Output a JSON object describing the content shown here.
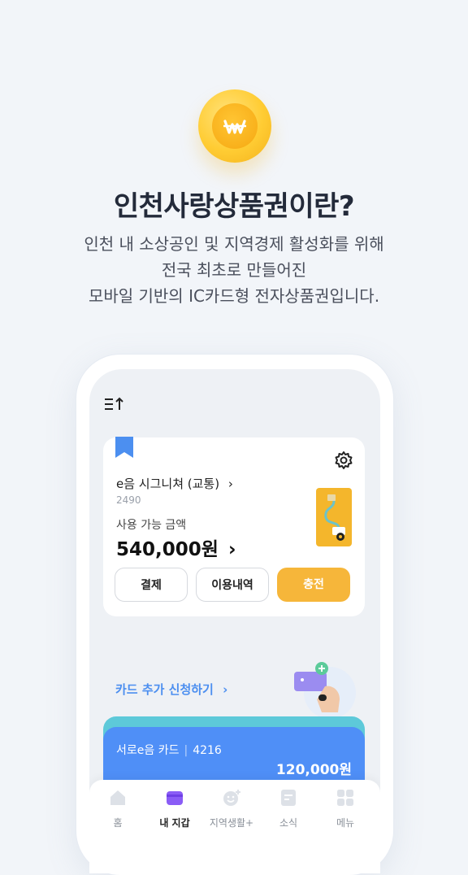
{
  "intro": {
    "title": "인천사랑상품권이란?",
    "desc_lines": [
      "인천 내 소상공인 및 지역경제 활성화를 위해",
      "전국 최초로 만들어진",
      "모바일 기반의 IC카드형 전자상품권입니다."
    ],
    "coin_icon": "won-coin-icon"
  },
  "wallet": {
    "card_name": "e음 시그니쳐 (교통)",
    "card_number": "2490",
    "available_label": "사용 가능 금액",
    "balance": "540,000원",
    "buttons": {
      "pay": "결제",
      "history": "이용내역",
      "charge": "충전"
    },
    "add_card": "카드 추가 신청하기"
  },
  "second_card": {
    "name": "서로e음 카드",
    "number": "4216",
    "balance": "120,000원"
  },
  "tabs": [
    {
      "label": "홈",
      "icon": "home-icon"
    },
    {
      "label": "내 지갑",
      "icon": "wallet-icon",
      "active": true
    },
    {
      "label": "지역생활+",
      "icon": "smile-plus-icon"
    },
    {
      "label": "소식",
      "icon": "news-icon"
    },
    {
      "label": "메뉴",
      "icon": "grid-menu-icon"
    }
  ],
  "colors": {
    "background": "#f2f5f9",
    "accent_yellow": "#f6b63a",
    "link_blue": "#4c8ff0",
    "card_blue": "#4f8ff7",
    "card_teal": "#5dc9d9",
    "wallet_purple": "#8a5cf6"
  }
}
